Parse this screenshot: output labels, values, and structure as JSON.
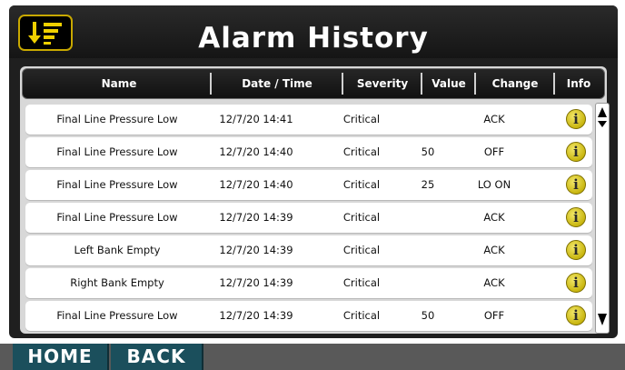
{
  "title": "Alarm History",
  "columns": [
    "Name",
    "Date / Time",
    "Severity",
    "Value",
    "Change",
    "Info"
  ],
  "rows": [
    {
      "name": "Final Line Pressure Low",
      "datetime": "12/7/20 14:41",
      "severity": "Critical",
      "value": "",
      "change": "ACK"
    },
    {
      "name": "Final Line Pressure Low",
      "datetime": "12/7/20 14:40",
      "severity": "Critical",
      "value": "50",
      "change": "OFF"
    },
    {
      "name": "Final Line Pressure Low",
      "datetime": "12/7/20 14:40",
      "severity": "Critical",
      "value": "25",
      "change": "LO ON"
    },
    {
      "name": "Final Line Pressure Low",
      "datetime": "12/7/20 14:39",
      "severity": "Critical",
      "value": "",
      "change": "ACK"
    },
    {
      "name": "Left Bank Empty",
      "datetime": "12/7/20 14:39",
      "severity": "Critical",
      "value": "",
      "change": "ACK"
    },
    {
      "name": "Right Bank Empty",
      "datetime": "12/7/20 14:39",
      "severity": "Critical",
      "value": "",
      "change": "ACK"
    },
    {
      "name": "Final Line Pressure Low",
      "datetime": "12/7/20 14:39",
      "severity": "Critical",
      "value": "50",
      "change": "OFF"
    }
  ],
  "info_glyph": "i",
  "nav": {
    "home": "HOME",
    "back": "BACK"
  },
  "colors": {
    "accent": "#c8a800",
    "nav_button": "#1b4f5c",
    "header_bg": "#111111",
    "info_icon": "#d4c020"
  },
  "icons": {
    "sort": "sort-descending-icon",
    "info": "info-icon",
    "scroll_up": "arrow-up-icon",
    "scroll_down": "arrow-down-icon"
  }
}
